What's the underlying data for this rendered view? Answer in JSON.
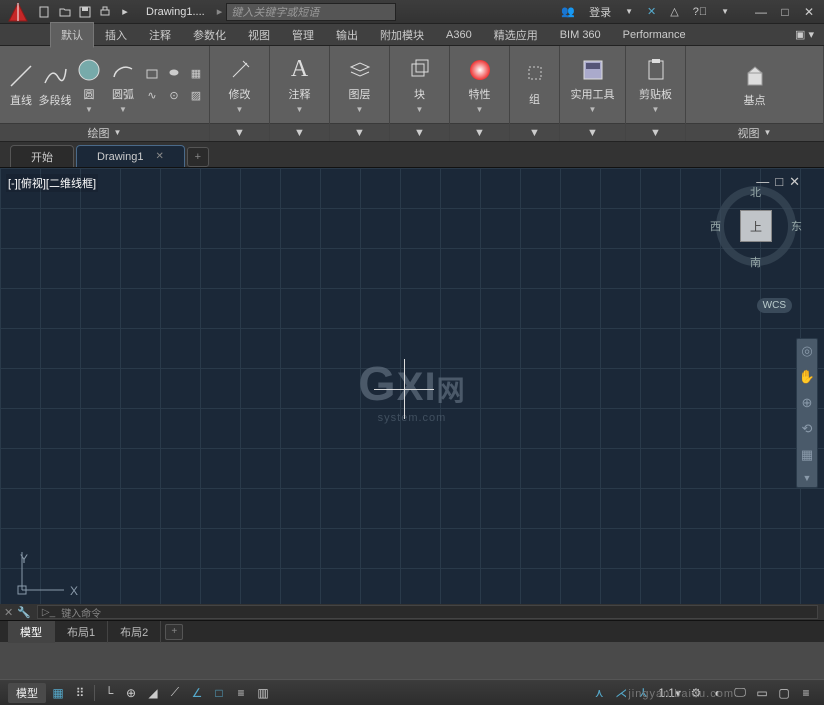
{
  "title": {
    "doc": "Drawing1....",
    "search_ph": "键入关键字或短语",
    "login": "登录"
  },
  "menus": {
    "items": [
      "默认",
      "插入",
      "注释",
      "参数化",
      "视图",
      "管理",
      "输出",
      "附加模块",
      "A360",
      "精选应用",
      "BIM 360",
      "Performance"
    ],
    "active": 0
  },
  "ribbon": {
    "draw": {
      "line": "直线",
      "pline": "多段线",
      "circle": "圆",
      "arc": "圆弧",
      "title": "绘图"
    },
    "modify": {
      "label": "修改"
    },
    "annot": {
      "label": "注释"
    },
    "layer": {
      "label": "图层"
    },
    "block": {
      "label": "块"
    },
    "props": {
      "label": "特性"
    },
    "group": {
      "label": "组"
    },
    "util": {
      "label": "实用工具"
    },
    "clip": {
      "label": "剪贴板"
    },
    "base": {
      "label": "基点",
      "title": "视图"
    }
  },
  "tabs": {
    "start": "开始",
    "drawing": "Drawing1"
  },
  "viewport": {
    "label": "[-][俯视][二维线框]",
    "cube": "上",
    "n": "北",
    "s": "南",
    "e": "东",
    "w": "西",
    "wcs": "WCS"
  },
  "watermark": {
    "main": "GXI网",
    "sub": "system.com"
  },
  "cmd": {
    "prompt": "键入命令"
  },
  "layouts": {
    "model": "模型",
    "l1": "布局1",
    "l2": "布局2"
  },
  "status": {
    "model": "模型",
    "scale": "1:1"
  },
  "footer_wm": "jingyan.baidu.com",
  "ucs": {
    "x": "X",
    "y": "Y"
  }
}
